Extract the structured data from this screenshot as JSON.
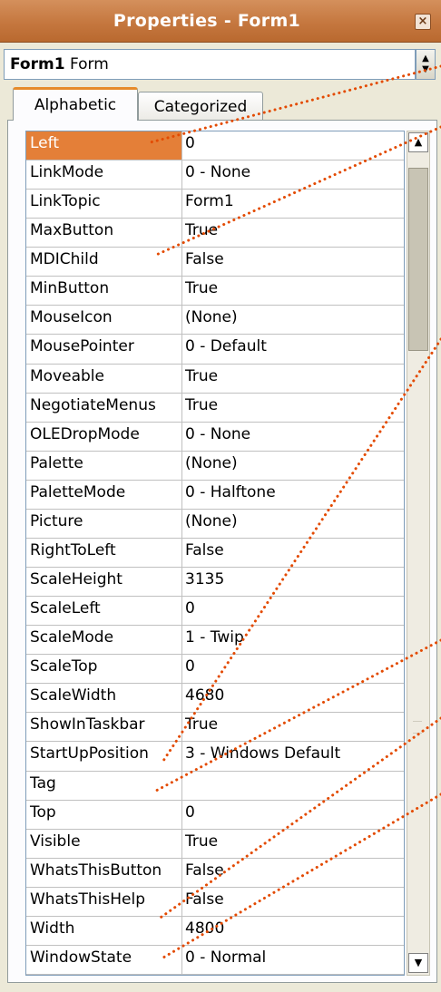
{
  "window": {
    "title": "Properties - Form1",
    "close_glyph": "×"
  },
  "object_selector": {
    "name": "Form1",
    "type": "Form"
  },
  "tabs": [
    {
      "label": "Alphabetic",
      "active": true
    },
    {
      "label": "Categorized",
      "active": false
    }
  ],
  "properties": [
    {
      "name": "Left",
      "value": "0"
    },
    {
      "name": "LinkMode",
      "value": "0 - None"
    },
    {
      "name": "LinkTopic",
      "value": "Form1"
    },
    {
      "name": "MaxButton",
      "value": "True"
    },
    {
      "name": "MDIChild",
      "value": "False"
    },
    {
      "name": "MinButton",
      "value": "True"
    },
    {
      "name": "MouseIcon",
      "value": "(None)"
    },
    {
      "name": "MousePointer",
      "value": "0 - Default"
    },
    {
      "name": "Moveable",
      "value": "True"
    },
    {
      "name": "NegotiateMenus",
      "value": "True"
    },
    {
      "name": "OLEDropMode",
      "value": "0 - None"
    },
    {
      "name": "Palette",
      "value": "(None)"
    },
    {
      "name": "PaletteMode",
      "value": "0 - Halftone"
    },
    {
      "name": "Picture",
      "value": "(None)"
    },
    {
      "name": "RightToLeft",
      "value": "False"
    },
    {
      "name": "ScaleHeight",
      "value": "3135"
    },
    {
      "name": "ScaleLeft",
      "value": "0"
    },
    {
      "name": "ScaleMode",
      "value": "1 - Twip"
    },
    {
      "name": "ScaleTop",
      "value": "0"
    },
    {
      "name": "ScaleWidth",
      "value": "4680"
    },
    {
      "name": "ShowInTaskbar",
      "value": "True"
    },
    {
      "name": "StartUpPosition",
      "value": "3 - Windows Default"
    },
    {
      "name": "Tag",
      "value": ""
    },
    {
      "name": "Top",
      "value": "0"
    },
    {
      "name": "Visible",
      "value": "True"
    },
    {
      "name": "WhatsThisButton",
      "value": "False"
    },
    {
      "name": "WhatsThisHelp",
      "value": "False"
    },
    {
      "name": "Width",
      "value": "4800"
    },
    {
      "name": "WindowState",
      "value": "0 - Normal"
    }
  ],
  "selected_property": "Left",
  "scrollbar": {
    "up_glyph": "▲",
    "down_glyph": "▼"
  },
  "colors": {
    "title_bar": "#c5773f",
    "selection": "#e47f38",
    "active_tab_accent": "#e68b2c",
    "annotation_dots": "#e34a00"
  }
}
